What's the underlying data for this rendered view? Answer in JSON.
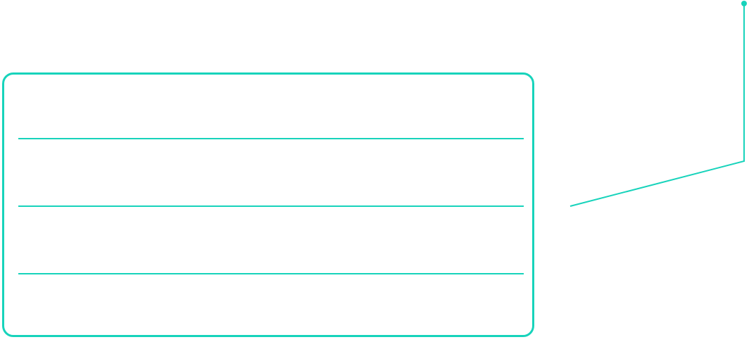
{
  "colors": {
    "accent": "#17d3bb",
    "background": "#ffffff"
  },
  "panel": {
    "rows": [
      {
        "text": ""
      },
      {
        "text": ""
      },
      {
        "text": ""
      },
      {
        "text": ""
      }
    ]
  }
}
